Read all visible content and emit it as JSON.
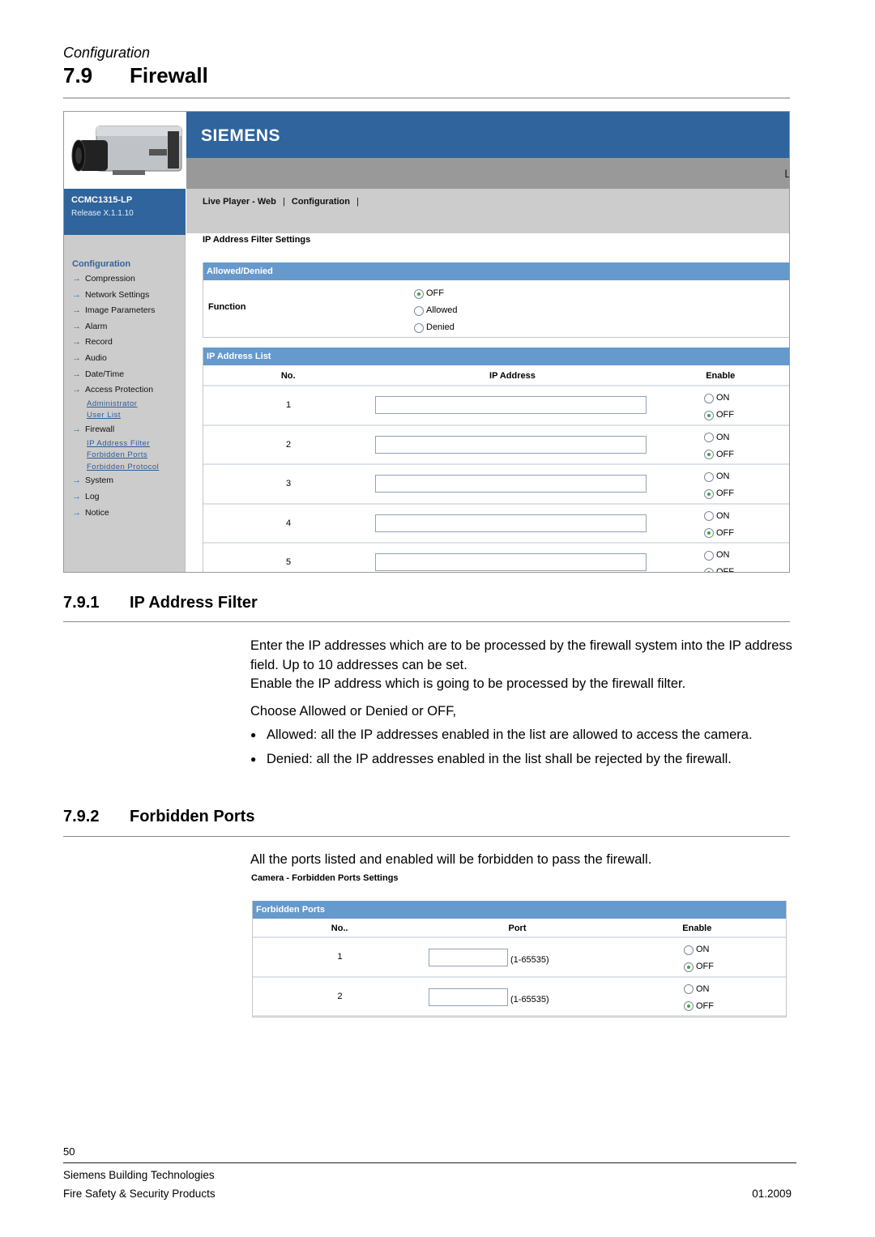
{
  "page": {
    "chapter": "Configuration",
    "section_number": "7.9",
    "section_title": "Firewall"
  },
  "screenshot": {
    "brand": "SIEMENS",
    "banner_cut_text": "L",
    "model": "CCMC1315-LP",
    "release": "Release X.1.1.10",
    "menu": [
      {
        "label": "Live Player - Web"
      },
      {
        "label": "Configuration"
      }
    ],
    "menu_separator": "|",
    "nav_title": "Configuration",
    "nav": [
      {
        "type": "item",
        "label": "Compression"
      },
      {
        "type": "item",
        "label": "Network Settings"
      },
      {
        "type": "item",
        "label": "Image Parameters"
      },
      {
        "type": "item",
        "label": "Alarm"
      },
      {
        "type": "item",
        "label": "Record"
      },
      {
        "type": "item",
        "label": "Audio"
      },
      {
        "type": "item",
        "label": "Date/Time"
      },
      {
        "type": "item",
        "label": "Access Protection"
      },
      {
        "type": "sub",
        "label": "Administrator"
      },
      {
        "type": "sub",
        "label": "User List"
      },
      {
        "type": "item",
        "label": "Firewall"
      },
      {
        "type": "sub",
        "label": "IP Address Filter"
      },
      {
        "type": "sub",
        "label": "Forbidden Ports"
      },
      {
        "type": "sub",
        "label": "Forbidden Protocol"
      },
      {
        "type": "item",
        "label": "System"
      },
      {
        "type": "item",
        "label": "Log"
      },
      {
        "type": "item",
        "label": "Notice"
      }
    ],
    "settings_title": "IP Address Filter Settings",
    "allowed_denied": {
      "header": "Allowed/Denied",
      "label": "Function",
      "options": [
        "OFF",
        "Allowed",
        "Denied"
      ],
      "selected": "OFF"
    },
    "ip_list": {
      "header": "IP Address List",
      "columns": [
        "No.",
        "IP Address",
        "Enable"
      ],
      "on_label": "ON",
      "off_label": "OFF",
      "rows": [
        {
          "no": "1",
          "ip": "",
          "enabled": false
        },
        {
          "no": "2",
          "ip": "",
          "enabled": false
        },
        {
          "no": "3",
          "ip": "",
          "enabled": false
        },
        {
          "no": "4",
          "ip": "",
          "enabled": false
        },
        {
          "no": "5",
          "ip": "",
          "enabled": false
        }
      ]
    }
  },
  "section_ip_filter": {
    "number": "7.9.1",
    "title": "IP Address Filter",
    "para1": "Enter the IP addresses which are to be processed by the firewall system into the IP address field. Up to 10 addresses can be set.",
    "para2": "Enable the IP address which is going to be processed by the firewall filter.",
    "para3": "Choose Allowed or Denied or OFF,",
    "bullets": [
      "Allowed: all the IP addresses enabled in the list are allowed to access the camera.",
      "Denied: all the IP addresses enabled in the list shall be rejected by the firewall."
    ]
  },
  "section_ports": {
    "number": "7.9.2",
    "title": "Forbidden Ports",
    "para": "All the ports listed and enabled will be forbidden to pass the firewall.",
    "shot_title": "Camera - Forbidden Ports Settings",
    "panel_header": "Forbidden Ports",
    "columns": [
      "No..",
      "Port",
      "Enable"
    ],
    "range_hint": "(1-65535)",
    "on_label": "ON",
    "off_label": "OFF",
    "rows": [
      {
        "no": "1",
        "port": "",
        "enabled": false
      },
      {
        "no": "2",
        "port": "",
        "enabled": false
      }
    ]
  },
  "footer": {
    "page_number": "50",
    "company": "Siemens Building Technologies",
    "division": "Fire Safety & Security Products",
    "date": "01.2009"
  }
}
